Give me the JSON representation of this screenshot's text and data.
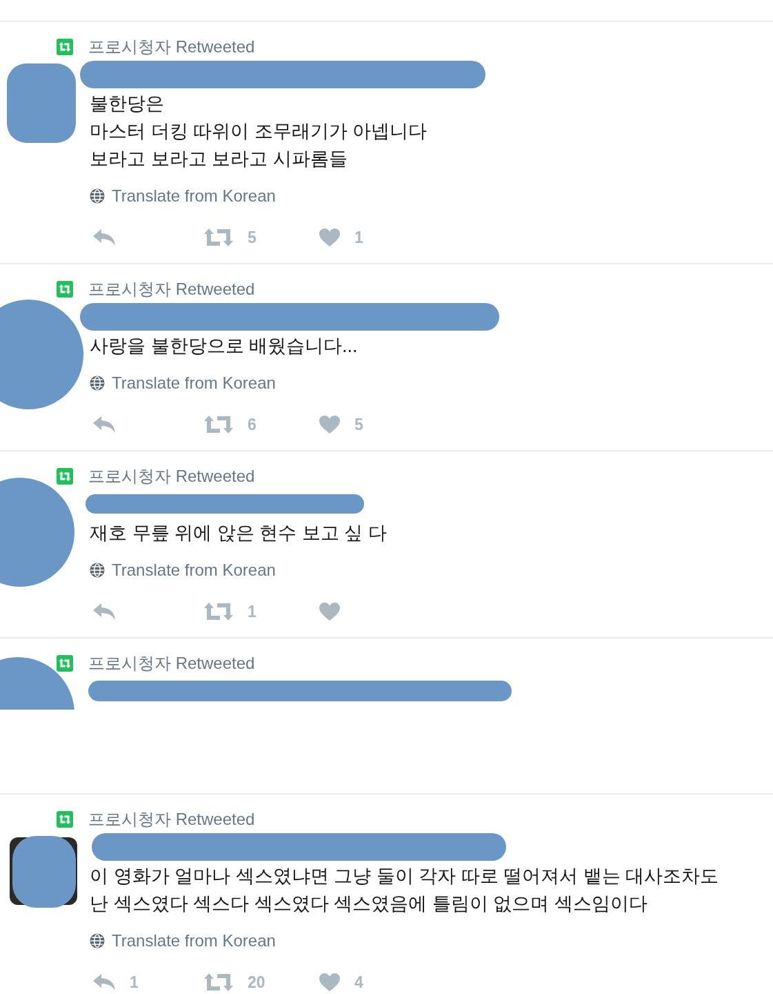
{
  "timeline": [
    {
      "header": "프로시청자 Retweeted",
      "cut_off": false,
      "text": "불한당은\n마스터 더킹 따위이 조무래기가 아넵니다\n보라고 보라고 보라고 시파롬들",
      "translate": "Translate from Korean",
      "retweets": "5",
      "likes": "1"
    },
    {
      "header": "프로시청자 Retweeted",
      "cut_off": false,
      "text": "사랑을 불한당으로 배웠습니다...",
      "translate": "Translate from Korean",
      "retweets": "6",
      "likes": "5"
    },
    {
      "header": "프로시청자 Retweeted",
      "cut_off": false,
      "text": "재호 무릎 위에 앉은 현수 보고 싶 다",
      "translate": "Translate from Korean",
      "retweets": "1"
    },
    {
      "header": "프로시청자 Retweeted",
      "cut_off": true
    },
    {
      "header": "프로시청자 Retweeted",
      "cut_off": false,
      "text": "이 영화가 얼마나 섹스였냐면 그냥 둘이 각자 따로 떨어져서 뱉는 대사조차도\n난 섹스였다 섹스다 섹스였다 섹스였음에 틀림이 없으며 섹스임이다",
      "translate": "Translate from Korean",
      "replies": "1",
      "retweets": "20",
      "likes": "4"
    }
  ]
}
